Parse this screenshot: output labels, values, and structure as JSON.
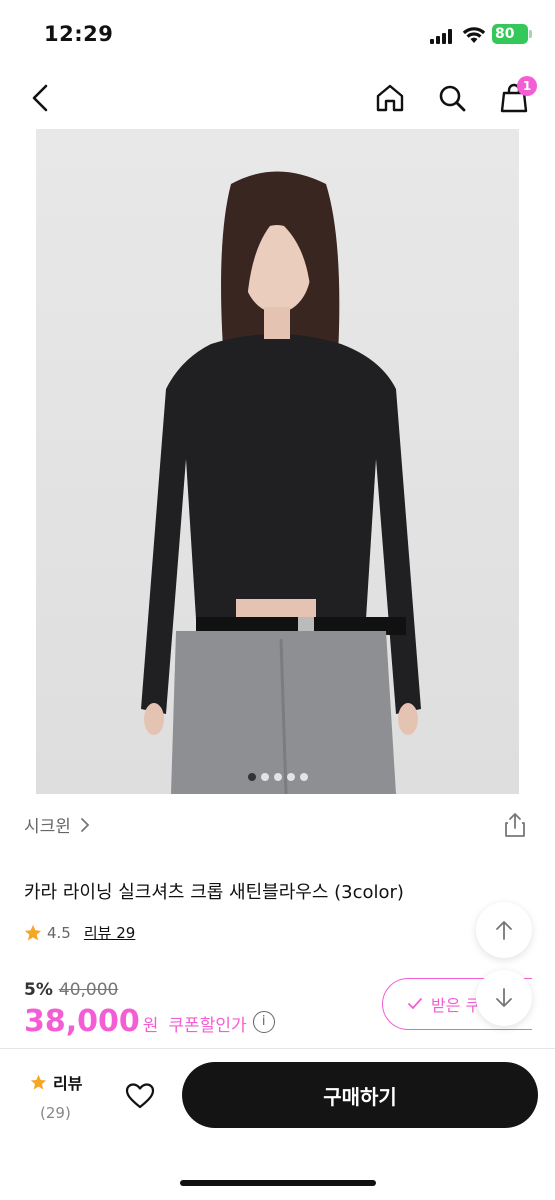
{
  "status_bar": {
    "time": "12:29",
    "battery": "80"
  },
  "header": {
    "cart_count": "1",
    "icons": [
      "back-icon",
      "home-icon",
      "search-icon",
      "shopping-bag-icon"
    ]
  },
  "gallery": {
    "page_count": 5,
    "current_index": 0
  },
  "brand": {
    "name": "시크윈"
  },
  "product": {
    "title": "카라 라이닝 실크셔츠 크롭 새틴블라우스 (3color)",
    "rating": "4.5",
    "review_link": "리뷰 29",
    "discount_rate": "5%",
    "original_price": "40,000",
    "sale_price": "38,000",
    "price_unit": "원",
    "coupon_label": "쿠폰할인가",
    "info_glyph": "i"
  },
  "coupon_button": {
    "label": "받은 쿠"
  },
  "bottom_bar": {
    "review_label": "리뷰",
    "review_count": "(29)",
    "buy_label": "구매하기"
  },
  "colors": {
    "accent": "#f35ed5",
    "buy_button": "#141414",
    "star": "#f5a623"
  }
}
